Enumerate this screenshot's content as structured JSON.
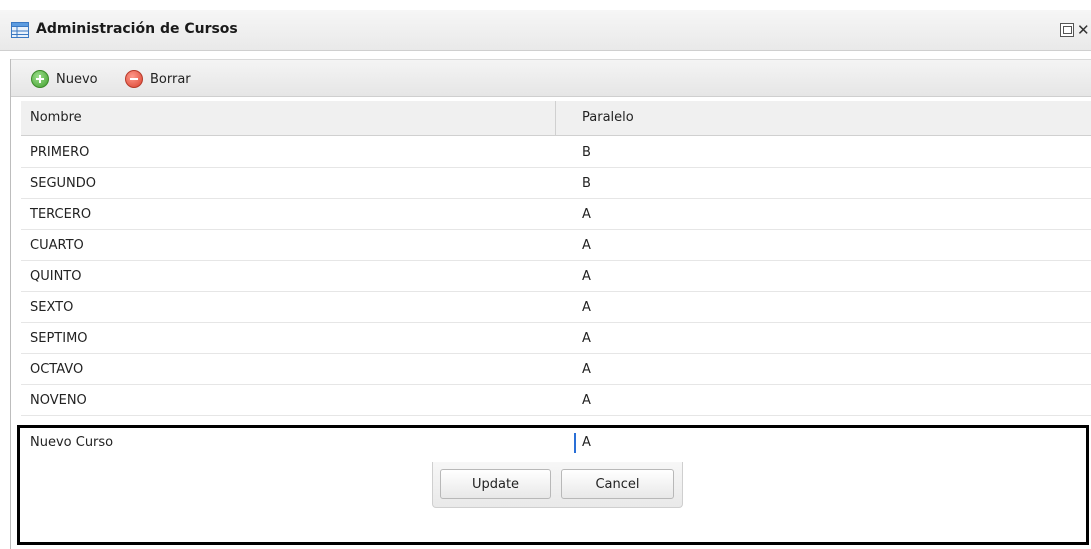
{
  "window": {
    "title": "Administración de Cursos",
    "close_symbol": "✕"
  },
  "toolbar": {
    "new_label": "Nuevo",
    "delete_label": "Borrar"
  },
  "grid": {
    "columns": [
      "Nombre",
      "Paralelo"
    ],
    "rows": [
      {
        "nombre": "PRIMERO",
        "paralelo": "B"
      },
      {
        "nombre": "SEGUNDO",
        "paralelo": "B"
      },
      {
        "nombre": "TERCERO",
        "paralelo": "A"
      },
      {
        "nombre": "CUARTO",
        "paralelo": "A"
      },
      {
        "nombre": "QUINTO",
        "paralelo": "A"
      },
      {
        "nombre": "SEXTO",
        "paralelo": "A"
      },
      {
        "nombre": "SEPTIMO",
        "paralelo": "A"
      },
      {
        "nombre": "OCTAVO",
        "paralelo": "A"
      },
      {
        "nombre": "NOVENO",
        "paralelo": "A"
      }
    ]
  },
  "editor": {
    "nombre_value": "Nuevo Curso",
    "paralelo_value": "A",
    "update_label": "Update",
    "cancel_label": "Cancel"
  }
}
